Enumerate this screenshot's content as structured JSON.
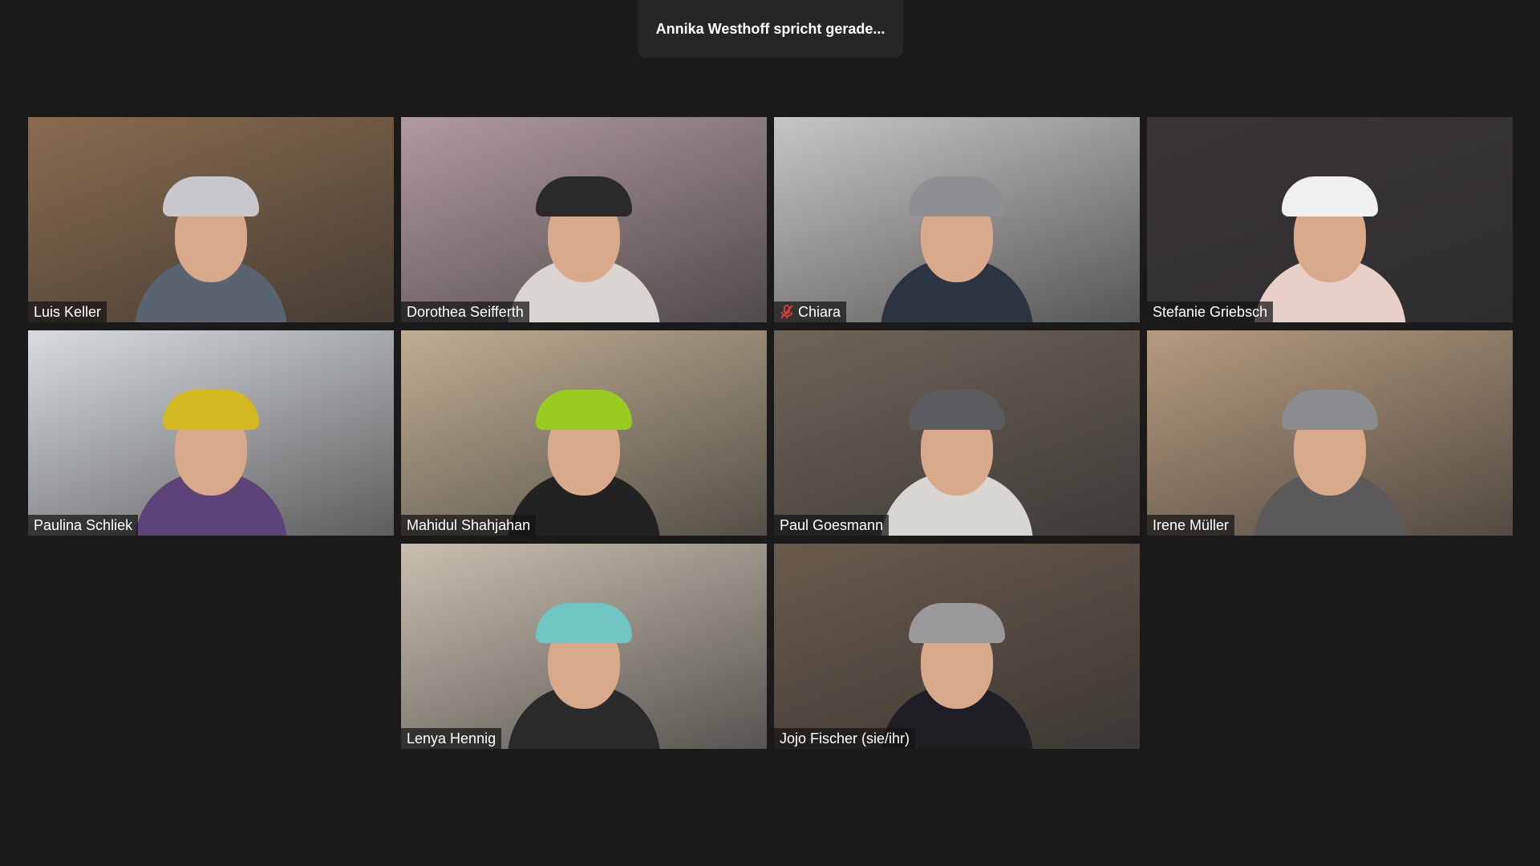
{
  "banner": {
    "speaking_text": "Annika Westhoff spricht gerade..."
  },
  "participants": [
    {
      "name": "Luis Keller",
      "muted": false,
      "bg": "#8a6b4e",
      "shirt": "#5a6470",
      "hat": "#c8c8cc"
    },
    {
      "name": "Dorothea Seifferth",
      "muted": false,
      "bg": "#b09aa0",
      "shirt": "#d9d4d0",
      "hat": "#2a2a2a"
    },
    {
      "name": "Chiara",
      "muted": true,
      "bg": "#c8c6c4",
      "shirt": "#2b3440",
      "hat": "#8d8f92"
    },
    {
      "name": "Stefanie Griebsch",
      "muted": false,
      "bg": "#3a3538",
      "shirt": "#e8d0c8",
      "hat": "#f0f0f0"
    },
    {
      "name": "Paulina Schliek",
      "muted": false,
      "bg": "#d8dce0",
      "shirt": "#5c4478",
      "hat": "#d4b820"
    },
    {
      "name": "Mahidul Shahjahan",
      "muted": false,
      "bg": "#bfae92",
      "shirt": "#222222",
      "hat": "#9acb20"
    },
    {
      "name": "Paul Goesmann",
      "muted": false,
      "bg": "#6f6458",
      "shirt": "#d8d6d2",
      "hat": "#5a5c60"
    },
    {
      "name": "Irene Müller",
      "muted": false,
      "bg": "#b69b7e",
      "shirt": "#5a5a5a",
      "hat": "#8a8c90"
    },
    {
      "name": "Lenya Hennig",
      "muted": false,
      "bg": "#c9bfb0",
      "shirt": "#2a2a2a",
      "hat": "#6fc6c2"
    },
    {
      "name": "Jojo Fischer (sie/ihr)",
      "muted": false,
      "bg": "#6a5a4c",
      "shirt": "#1e1e24",
      "hat": "#9a9a9c"
    }
  ]
}
